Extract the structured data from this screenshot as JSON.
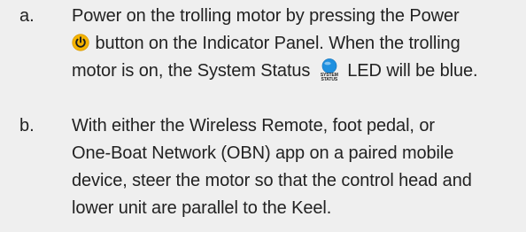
{
  "steps": [
    {
      "letter": "a.",
      "line1": "Power on the trolling motor by pressing the Power",
      "line2_after_icon": " button on the Indicator Panel. When the trolling",
      "line3_before_icon": "motor is on, the System Status ",
      "line3_after_icon": " LED will be blue."
    },
    {
      "letter": "b.",
      "lines": [
        "With either the Wireless Remote, foot pedal, or",
        "One-Boat Network (OBN) app on a paired mobile",
        "device, steer the motor so that the control head and",
        "lower unit are parallel to the Keel."
      ]
    }
  ],
  "icons": {
    "power": {
      "name": "power-icon",
      "color": "#f5b400"
    },
    "system_status": {
      "name": "system-status-led-icon",
      "color": "#1e90e0",
      "caption_line1": "SYSTEM",
      "caption_line2": "STATUS"
    }
  }
}
